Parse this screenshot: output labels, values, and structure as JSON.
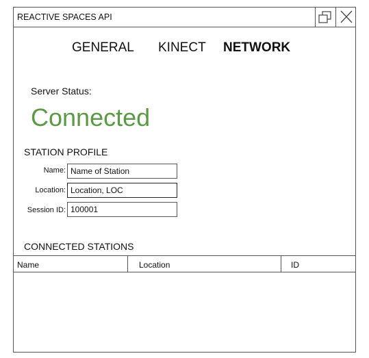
{
  "window": {
    "title": "REACTIVE SPACES API",
    "controls": {
      "restore_icon": "restore-icon",
      "close_icon": "close-icon"
    }
  },
  "tabs": [
    {
      "label": "GENERAL",
      "active": false
    },
    {
      "label": "KINECT",
      "active": false
    },
    {
      "label": "NETWORK",
      "active": true
    }
  ],
  "server": {
    "status_label": "Server Status:",
    "status_value": "Connected",
    "status_color": "#5a9a45"
  },
  "station_profile": {
    "title": "STATION PROFILE",
    "fields": {
      "name": {
        "label": "Name:",
        "value": "Name of Station"
      },
      "location": {
        "label": "Location:",
        "value": "Location, LOC"
      },
      "session_id": {
        "label": "Session ID:",
        "value": "100001"
      }
    }
  },
  "connected_stations": {
    "title": "CONNECTED STATIONS",
    "columns": [
      "Name",
      "Location",
      "ID"
    ],
    "rows": []
  }
}
